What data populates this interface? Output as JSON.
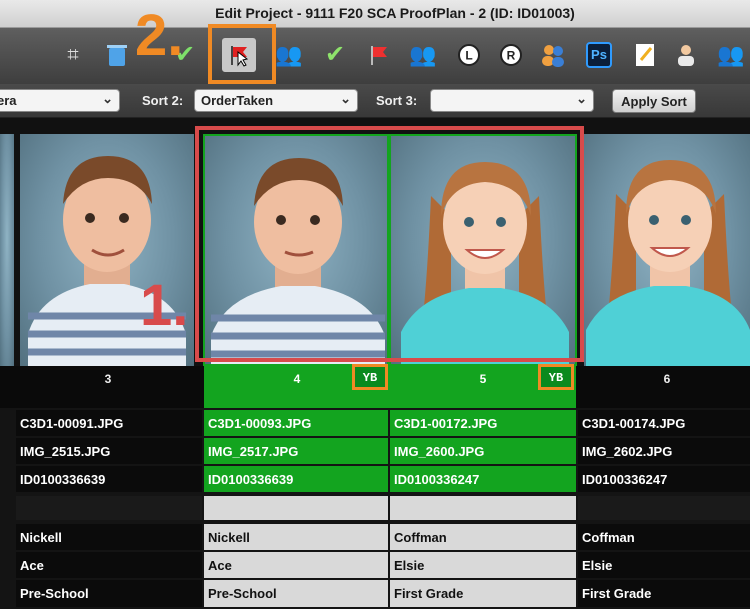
{
  "window": {
    "title": "Edit Project - 9111 F20 SCA ProofPlan - 2 (ID: ID01003)"
  },
  "toolbar": {
    "icons": [
      "crop-icon",
      "trash-icon",
      "check-icon",
      "flag-icon",
      "people-icon",
      "check-icon",
      "flag-icon",
      "people-icon",
      "rotate-left-icon",
      "rotate-right-icon",
      "people-icon",
      "photoshop-icon",
      "notepad-icon",
      "person-icon",
      "people-icon"
    ],
    "ps_label": "Ps",
    "rotate_left_label": "L",
    "rotate_right_label": "R"
  },
  "annotations": {
    "step1": "1.",
    "step2": "2."
  },
  "sort": {
    "sort1_value": "era",
    "sort2_label": "Sort 2:",
    "sort2_value": "OrderTaken",
    "sort3_label": "Sort 3:",
    "sort3_value": "",
    "apply_label": "Apply Sort"
  },
  "badges": {
    "yb4": "YB",
    "yb5": "YB"
  },
  "columns": [
    {
      "number": "3",
      "file1": "C3D1-00091.JPG",
      "file2": "IMG_2515.JPG",
      "id": "ID0100336639",
      "blank": "",
      "last": "Nickell",
      "first": "Ace",
      "grade": "Pre-School"
    },
    {
      "number": "4",
      "file1": "C3D1-00093.JPG",
      "file2": "IMG_2517.JPG",
      "id": "ID0100336639",
      "blank": "",
      "last": "Nickell",
      "first": "Ace",
      "grade": "Pre-School"
    },
    {
      "number": "5",
      "file1": "C3D1-00172.JPG",
      "file2": "IMG_2600.JPG",
      "id": "ID0100336247",
      "blank": "",
      "last": "Coffman",
      "first": "Elsie",
      "grade": "First Grade"
    },
    {
      "number": "6",
      "file1": "C3D1-00174.JPG",
      "file2": "IMG_2602.JPG",
      "id": "ID0100336247",
      "blank": "",
      "last": "Coffman",
      "first": "Elsie",
      "grade": "First Grade"
    }
  ],
  "colors": {
    "selected": "#13a41f",
    "highlight_red": "#d84b4b",
    "highlight_orange": "#f08a24"
  }
}
